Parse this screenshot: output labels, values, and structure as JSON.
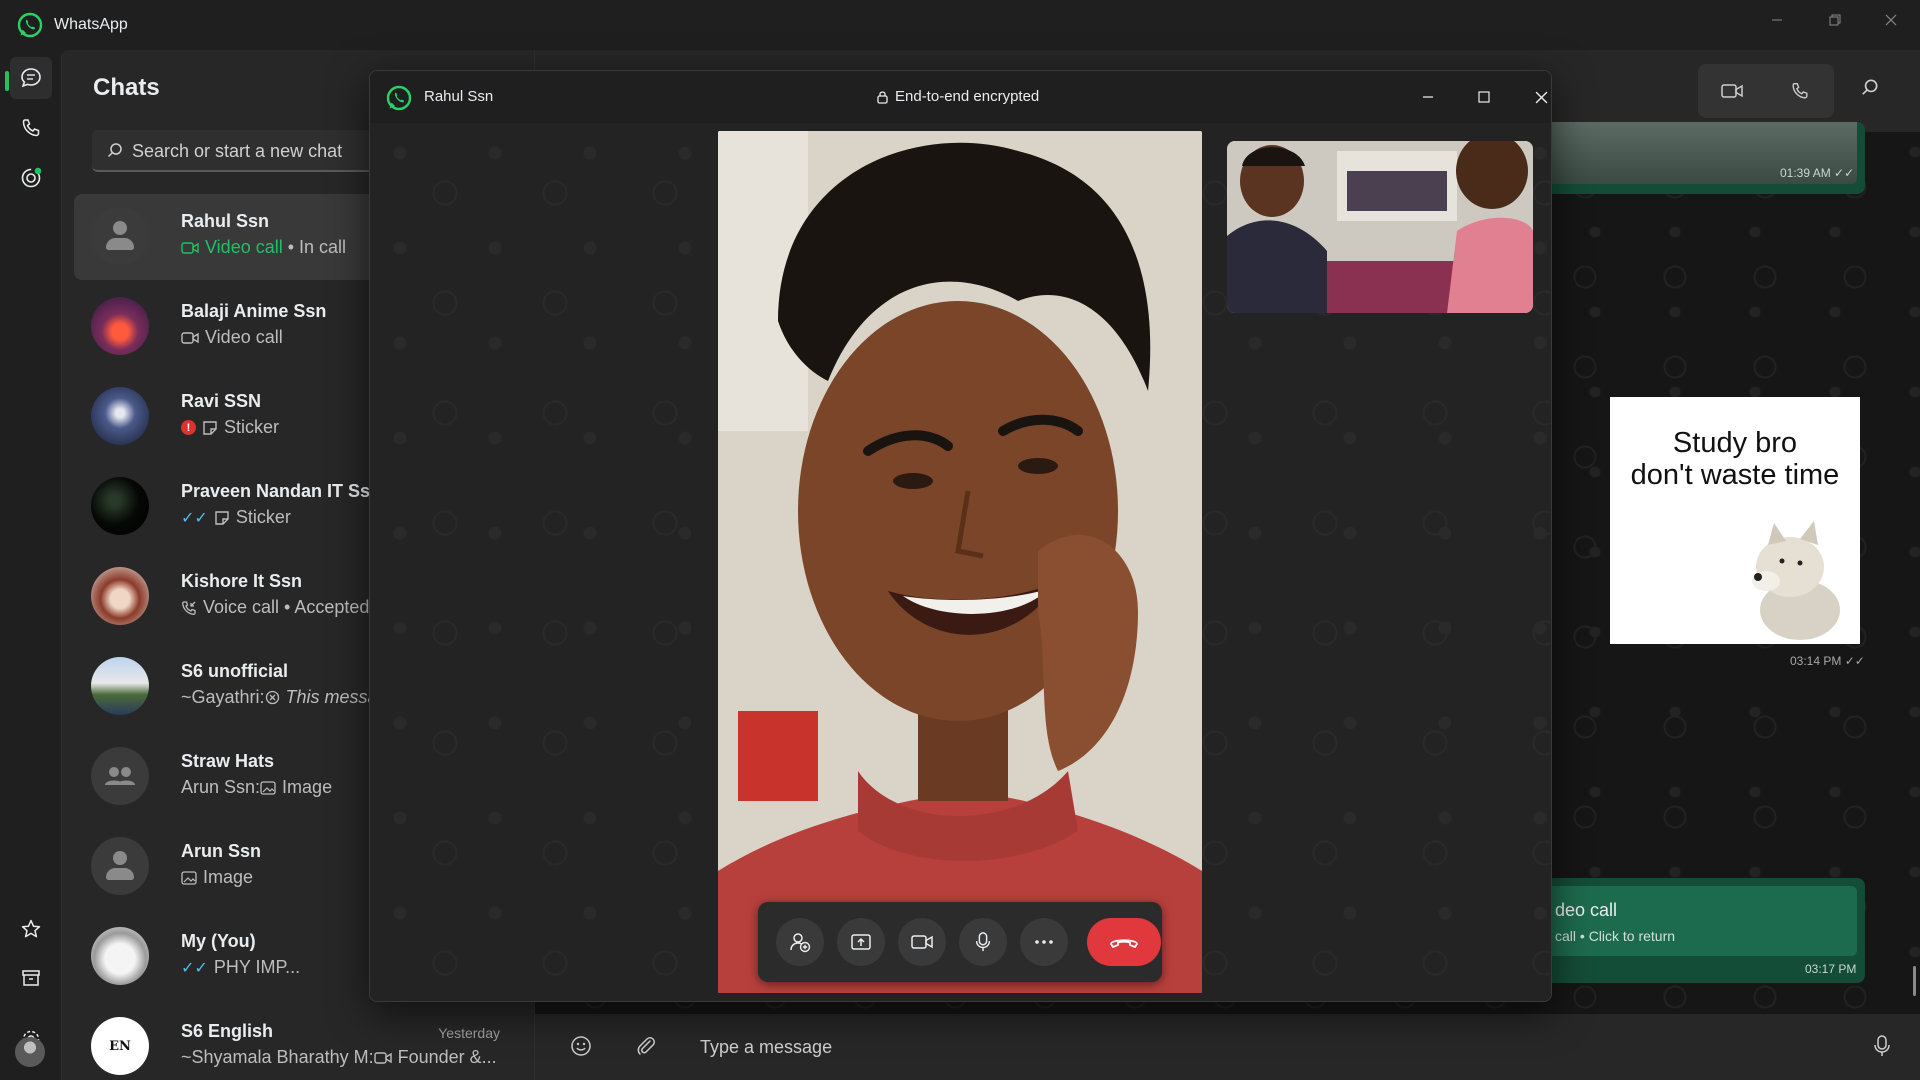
{
  "app": {
    "title": "WhatsApp"
  },
  "chat_list": {
    "title": "Chats",
    "search_placeholder": "Search or start a new chat",
    "items": [
      {
        "name": "Rahul Ssn",
        "sub_highlight": "Video call",
        "sub": " • In call",
        "time": ""
      },
      {
        "name": "Balaji Anime Ssn",
        "sub": "Video call",
        "time": ""
      },
      {
        "name": "Ravi SSN",
        "sub": "Sticker",
        "time": ""
      },
      {
        "name": "Praveen Nandan IT Ssn",
        "sub": "Sticker",
        "time": ""
      },
      {
        "name": "Kishore It Ssn",
        "sub": "Voice call • Accepted o",
        "time": ""
      },
      {
        "name": "S6 unofficial",
        "sub_prefix": "~Gayathri: ",
        "sub": "This messag",
        "time": ""
      },
      {
        "name": "Straw Hats",
        "sub_prefix": "Arun Ssn: ",
        "sub": "Image",
        "time": ""
      },
      {
        "name": "Arun Ssn",
        "sub": "Image",
        "time": ""
      },
      {
        "name": "My (You)",
        "sub": "PHY IMP...",
        "time": ""
      },
      {
        "name": "S6 English",
        "sub_prefix": "~Shyamala Bharathy M: ",
        "sub": "Founder &...",
        "time": "Yesterday"
      }
    ]
  },
  "conversation": {
    "msg1_time": "01:39 AM",
    "sticker_line1": "Study bro",
    "sticker_line2": "don't waste time",
    "sticker_time": "03:14 PM",
    "call_bubble_title": "deo call",
    "call_bubble_sub": "call • Click to return",
    "call_bubble_time": "03:17 PM",
    "compose_placeholder": "Type a message"
  },
  "call_window": {
    "contact_name": "Rahul Ssn",
    "encryption_label": "End-to-end encrypted"
  },
  "colors": {
    "accent": "#21c063",
    "end_call": "#e0383c",
    "outgoing_bubble": "#144d37",
    "read_ticks": "#53bdeb"
  },
  "icons": [
    "whatsapp-logo-icon",
    "chats-icon",
    "calls-icon",
    "status-icon",
    "star-icon",
    "archive-icon",
    "settings-icon",
    "search-icon",
    "video-camera-icon",
    "phone-icon",
    "emoji-icon",
    "paperclip-icon",
    "microphone-icon",
    "lock-icon",
    "add-participant-icon",
    "share-screen-icon",
    "more-icon",
    "end-call-icon"
  ]
}
